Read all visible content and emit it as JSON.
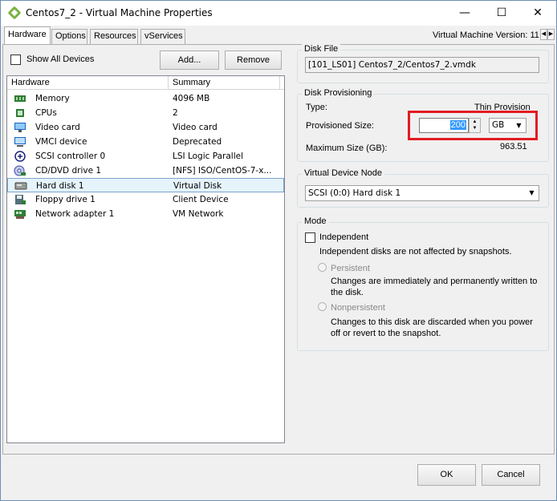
{
  "window": {
    "title": "Centos7_2 - Virtual Machine Properties",
    "controls": {
      "minimize": "—",
      "maximize": "☐",
      "close": "✕"
    }
  },
  "tabs": [
    {
      "label": "Hardware",
      "active": true
    },
    {
      "label": "Options",
      "active": false
    },
    {
      "label": "Resources",
      "active": false
    },
    {
      "label": "vServices",
      "active": false
    }
  ],
  "vm_version": "Virtual Machine Version: 11",
  "hardware_panel": {
    "show_all_devices_label": "Show All Devices",
    "show_all_devices_checked": false,
    "add_button": "Add...",
    "remove_button": "Remove",
    "columns": {
      "hardware": "Hardware",
      "summary": "Summary"
    },
    "rows": [
      {
        "name": "Memory",
        "summary": "4096 MB",
        "icon": "memory-icon"
      },
      {
        "name": "CPUs",
        "summary": "2",
        "icon": "cpu-icon"
      },
      {
        "name": "Video card",
        "summary": "Video card",
        "icon": "monitor-icon"
      },
      {
        "name": "VMCI device",
        "summary": "Deprecated",
        "icon": "vmci-icon"
      },
      {
        "name": "SCSI controller 0",
        "summary": "LSI Logic Parallel",
        "icon": "scsi-icon"
      },
      {
        "name": "CD/DVD drive 1",
        "summary": "[NFS] ISO/CentOS-7-x...",
        "icon": "cd-icon"
      },
      {
        "name": "Hard disk 1",
        "summary": "Virtual Disk",
        "icon": "hard-disk-icon",
        "selected": true
      },
      {
        "name": "Floppy drive 1",
        "summary": "Client Device",
        "icon": "floppy-icon"
      },
      {
        "name": "Network adapter 1",
        "summary": "VM Network",
        "icon": "network-icon"
      }
    ]
  },
  "disk_file": {
    "group_label": "Disk File",
    "value": "[101_LS01] Centos7_2/Centos7_2.vmdk"
  },
  "disk_provisioning": {
    "group_label": "Disk Provisioning",
    "type_label": "Type:",
    "type_value": "Thin Provision",
    "provisioned_label": "Provisioned Size:",
    "provisioned_value": "200",
    "unit": "GB",
    "max_label": "Maximum Size (GB):",
    "max_value": "963.51"
  },
  "virtual_device_node": {
    "group_label": "Virtual Device Node",
    "value": "SCSI (0:0) Hard disk 1"
  },
  "mode": {
    "group_label": "Mode",
    "independent_label": "Independent",
    "independent_checked": false,
    "independent_desc": "Independent disks are not affected by snapshots.",
    "persistent_label": "Persistent",
    "persistent_desc_1": "Changes are immediately and permanently written to",
    "persistent_desc_2": "the disk.",
    "nonpersistent_label": "Nonpersistent",
    "nonpersistent_desc_1": "Changes to this disk are discarded when you power",
    "nonpersistent_desc_2": "off or revert to the snapshot."
  },
  "footer": {
    "ok": "OK",
    "cancel": "Cancel"
  },
  "colors": {
    "highlight": "#e21b22",
    "selection": "#e5f3fb",
    "selection_border": "#7da2ce"
  }
}
